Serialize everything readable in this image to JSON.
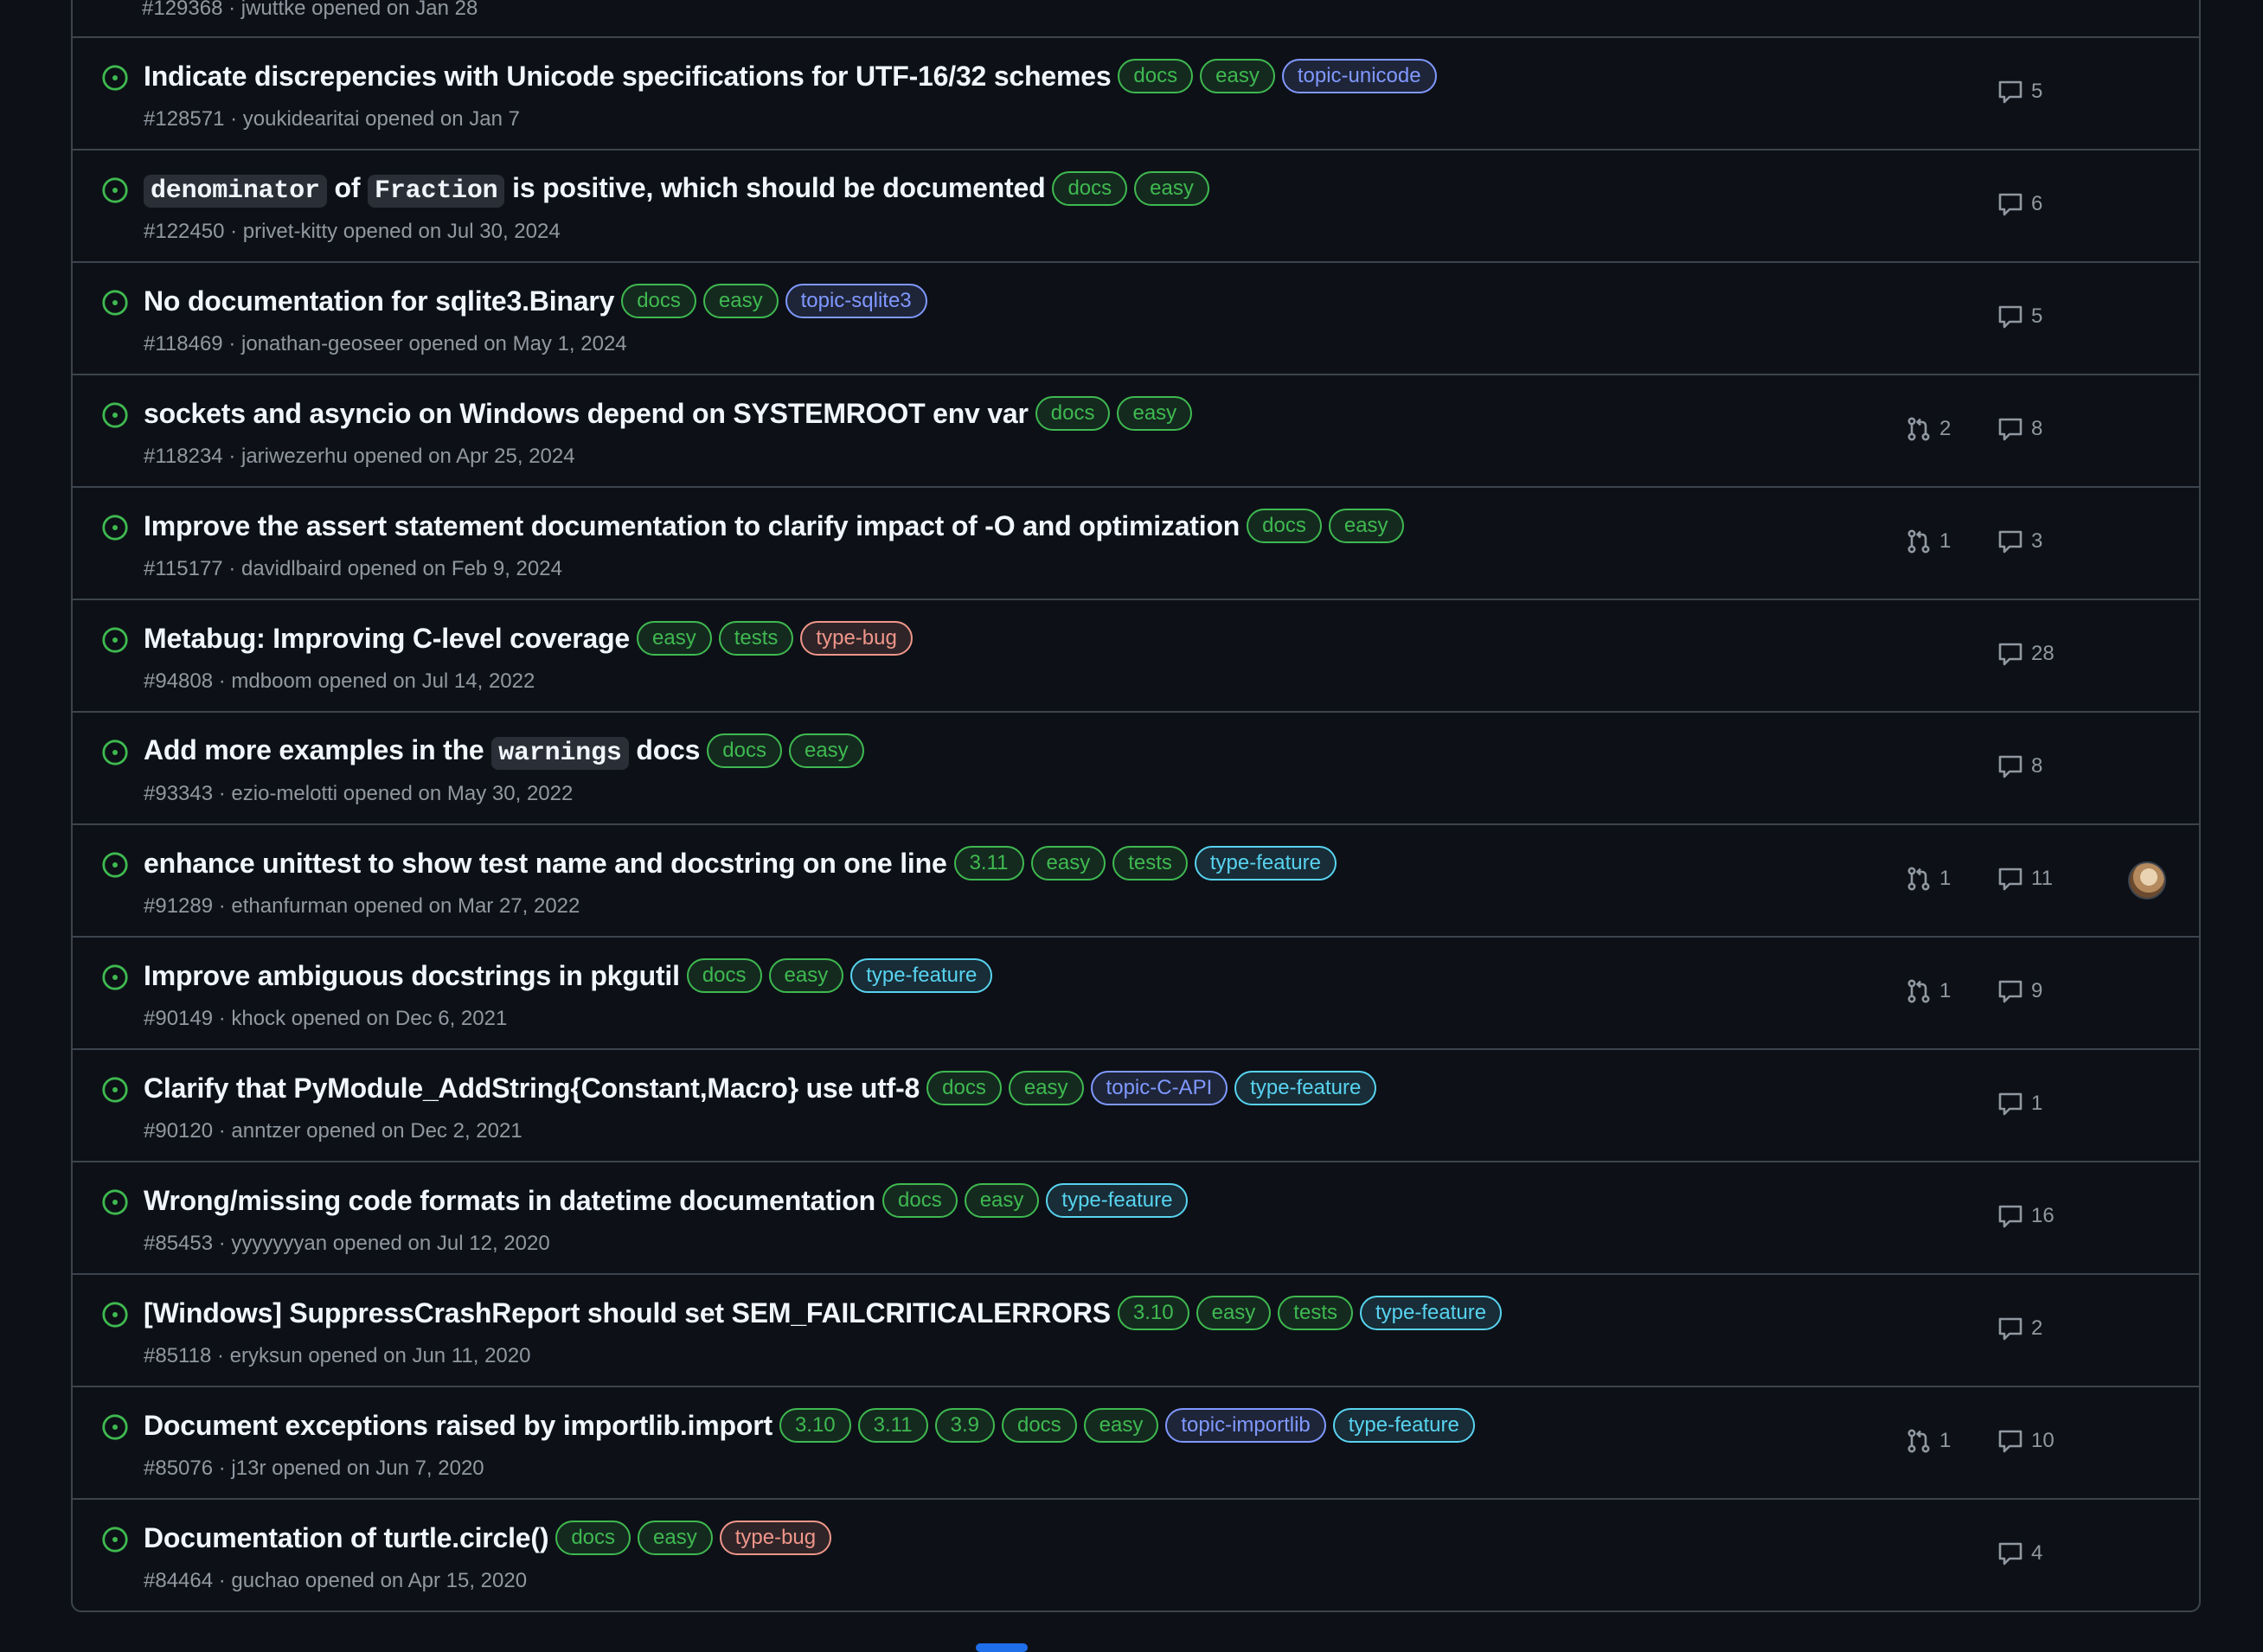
{
  "partial_row_meta": "#129368 · jwuttke opened on Jan 28",
  "colors": {
    "background": "#0d1117",
    "border": "#3d444d",
    "open_icon": "#3fb950",
    "muted_text": "#9198a1",
    "label_docs": "#3fb950",
    "label_topic": "#8098ff",
    "label_type_feature": "#58d3f0",
    "label_type_bug": "#f0968a"
  },
  "issues": [
    {
      "title": [
        "Indicate discrepencies with Unicode specifications for UTF-16/32 schemes"
      ],
      "labels": [
        "docs",
        "easy",
        "topic-unicode"
      ],
      "meta": "#128571 · youkidearitai opened on Jan 7",
      "linked_prs": "",
      "comments": "5"
    },
    {
      "title": [
        "denominator",
        " of ",
        "Fraction",
        " is positive, which should be documented"
      ],
      "labels": [
        "docs",
        "easy"
      ],
      "meta": "#122450 · privet-kitty opened on Jul 30, 2024",
      "linked_prs": "",
      "comments": "6"
    },
    {
      "title": [
        "No documentation for sqlite3.Binary"
      ],
      "labels": [
        "docs",
        "easy",
        "topic-sqlite3"
      ],
      "meta": "#118469 · jonathan-geoseer opened on May 1, 2024",
      "linked_prs": "",
      "comments": "5"
    },
    {
      "title": [
        "sockets and asyncio on Windows depend on SYSTEMROOT env var"
      ],
      "labels": [
        "docs",
        "easy"
      ],
      "meta": "#118234 · jariwezerhu opened on Apr 25, 2024",
      "linked_prs": "2",
      "comments": "8"
    },
    {
      "title": [
        "Improve the assert statement documentation to clarify impact of -O and optimization"
      ],
      "labels": [
        "docs",
        "easy"
      ],
      "meta": "#115177 · davidlbaird opened on Feb 9, 2024",
      "linked_prs": "1",
      "comments": "3"
    },
    {
      "title": [
        "Metabug: Improving C-level coverage"
      ],
      "labels": [
        "easy",
        "tests",
        "type-bug"
      ],
      "meta": "#94808 · mdboom opened on Jul 14, 2022",
      "linked_prs": "",
      "comments": "28"
    },
    {
      "title": [
        "Add more examples in the ",
        "warnings",
        " docs"
      ],
      "labels": [
        "docs",
        "easy"
      ],
      "meta": "#93343 · ezio-melotti opened on May 30, 2022",
      "linked_prs": "",
      "comments": "8"
    },
    {
      "title": [
        "enhance unittest to show test name and docstring on one line"
      ],
      "labels": [
        "3.11",
        "easy",
        "tests",
        "type-feature"
      ],
      "meta": "#91289 · ethanfurman opened on Mar 27, 2022",
      "linked_prs": "1",
      "comments": "11",
      "assignee_avatar": true
    },
    {
      "title": [
        "Improve ambiguous docstrings in pkgutil"
      ],
      "labels": [
        "docs",
        "easy",
        "type-feature"
      ],
      "meta": "#90149 · khock opened on Dec 6, 2021",
      "linked_prs": "1",
      "comments": "9"
    },
    {
      "title": [
        "Clarify that PyModule_AddString{Constant,Macro} use utf-8"
      ],
      "labels": [
        "docs",
        "easy",
        "topic-C-API",
        "type-feature"
      ],
      "meta": "#90120 · anntzer opened on Dec 2, 2021",
      "linked_prs": "",
      "comments": "1"
    },
    {
      "title": [
        "Wrong/missing code formats in datetime documentation"
      ],
      "labels": [
        "docs",
        "easy",
        "type-feature"
      ],
      "meta": "#85453 · yyyyyyyan opened on Jul 12, 2020",
      "linked_prs": "",
      "comments": "16"
    },
    {
      "title": [
        "[Windows] SuppressCrashReport should set SEM_FAILCRITICALERRORS"
      ],
      "labels": [
        "3.10",
        "easy",
        "tests",
        "type-feature"
      ],
      "meta": "#85118 · eryksun opened on Jun 11, 2020",
      "linked_prs": "",
      "comments": "2"
    },
    {
      "title": [
        "Document exceptions raised by importlib.import"
      ],
      "labels": [
        "3.10",
        "3.11",
        "3.9",
        "docs",
        "easy",
        "topic-importlib",
        "type-feature"
      ],
      "meta": "#85076 · j13r opened on Jun 7, 2020",
      "linked_prs": "1",
      "comments": "10"
    },
    {
      "title": [
        "Documentation of turtle.circle()"
      ],
      "labels": [
        "docs",
        "easy",
        "type-bug"
      ],
      "meta": "#84464 · guchao opened on Apr 15, 2020",
      "linked_prs": "",
      "comments": "4"
    }
  ]
}
